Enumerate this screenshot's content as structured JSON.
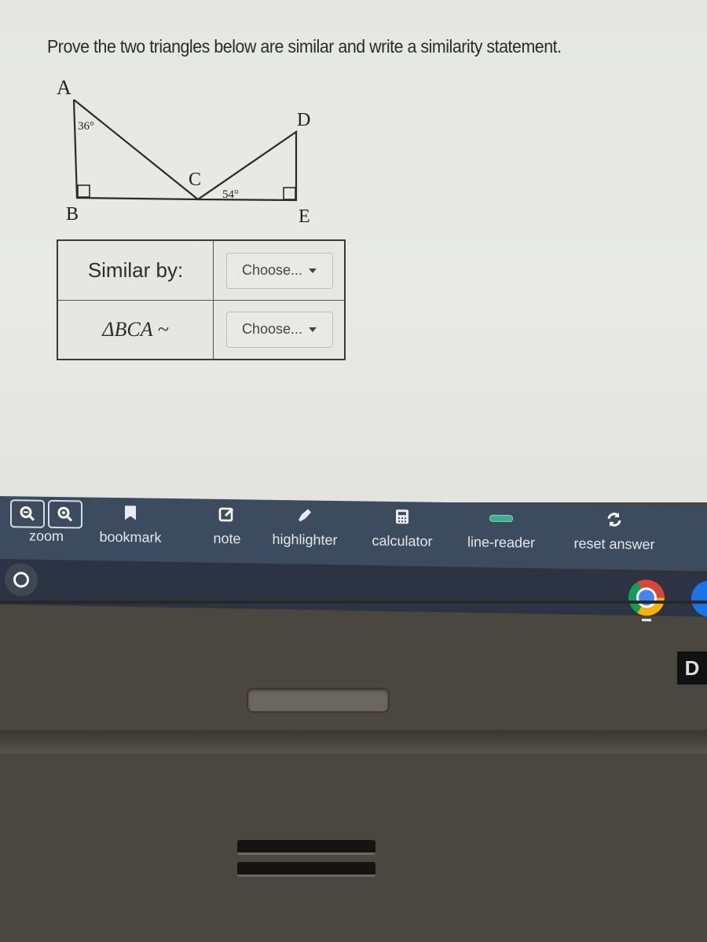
{
  "question": {
    "text": "Prove the two triangles below are similar and write a similarity statement."
  },
  "figure": {
    "vertices": [
      "A",
      "B",
      "C",
      "D",
      "E"
    ],
    "angle_A": "36°",
    "angle_DCE": "54°",
    "right_angles": [
      "B",
      "E"
    ]
  },
  "answer_table": {
    "rows": [
      {
        "label": "Similar by:",
        "select_value": "Choose..."
      },
      {
        "label": "ΔBCA ~",
        "select_value": "Choose..."
      }
    ]
  },
  "toolbar": {
    "zoom_label": "zoom",
    "bookmark_label": "bookmark",
    "note_label": "note",
    "highlighter_label": "highlighter",
    "calculator_label": "calculator",
    "line_reader_label": "line-reader",
    "reset_label": "reset answer",
    "line_reader_color": "#3fae8c"
  },
  "shelf": {
    "apps": [
      "launcher",
      "chrome",
      "files"
    ]
  },
  "hardware": {
    "badge_text": "D"
  }
}
